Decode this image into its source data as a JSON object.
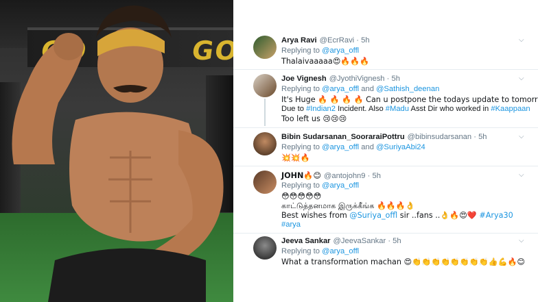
{
  "photo": {
    "sign_text": [
      "GO",
      "GO"
    ],
    "alt": "muscular man flexing in gym"
  },
  "tweets": [
    {
      "name": "Arya Ravi",
      "handle": "@EcrRavi",
      "time": "5h",
      "replying_prefix": "Replying to",
      "mentions": [
        "@arya_offl"
      ],
      "lines": [
        "Thalaivaaaaa😍🔥🔥🔥"
      ]
    },
    {
      "name": "Joe Vignesh",
      "handle": "@JyothiVignesh",
      "time": "5h",
      "replying_prefix": "Replying to",
      "mentions": [
        "@arya_offl",
        "@Sathish_deenan"
      ],
      "and": "and",
      "line1": "It's Huge 🔥 🔥 🔥 🔥  Can u postpone the todays update to tomorrow.",
      "line2_a": "Due to ",
      "line2_link1": "#Indian2",
      "line2_b": " Incident. Also ",
      "line2_link2": "#Madu",
      "line2_c": " Asst Dir who worked in ",
      "line2_link3": "#Kaappaan",
      "line3": " Too left us 😢😢😢"
    },
    {
      "name": "Bibin Sudarsanan_SooraraiPottru",
      "handle": "@bibinsudarsanan",
      "time": "5h",
      "replying_prefix": "Replying to",
      "mentions": [
        "@arya_offl",
        "@SuriyaAbi24"
      ],
      "and": "and",
      "lines": [
        "💥💥🔥"
      ]
    },
    {
      "name": "JOHN🔥😊",
      "handle": "@antojohn9",
      "time": "5h",
      "replying_prefix": "Replying to",
      "mentions": [
        "@arya_offl"
      ],
      "line1": "😳😳😳😳😳",
      "line2": "காட்டுத்தனமாக இருக்கீங்க 🔥🔥🔥👌",
      "line3_a": "Best wishes from ",
      "line3_link1": "@Suriya_offl",
      "line3_b": " sir ..fans ..👌🔥😍❤️ ",
      "line3_link2": "#Arya30",
      "line4": "#arya"
    },
    {
      "name": "Jeeva Sankar",
      "handle": "@JeevaSankar",
      "time": "5h",
      "replying_prefix": "Replying to",
      "mentions": [
        "@arya_offl"
      ],
      "lines": [
        "What a transformation machan 😍👏👏👏👏👏👏👏👏👍💪🔥😊"
      ]
    }
  ],
  "icons": {
    "chevron": "chevron-down-icon"
  },
  "colors": {
    "link": "#1b95e0",
    "name": "#14171a",
    "muted": "#657786"
  }
}
